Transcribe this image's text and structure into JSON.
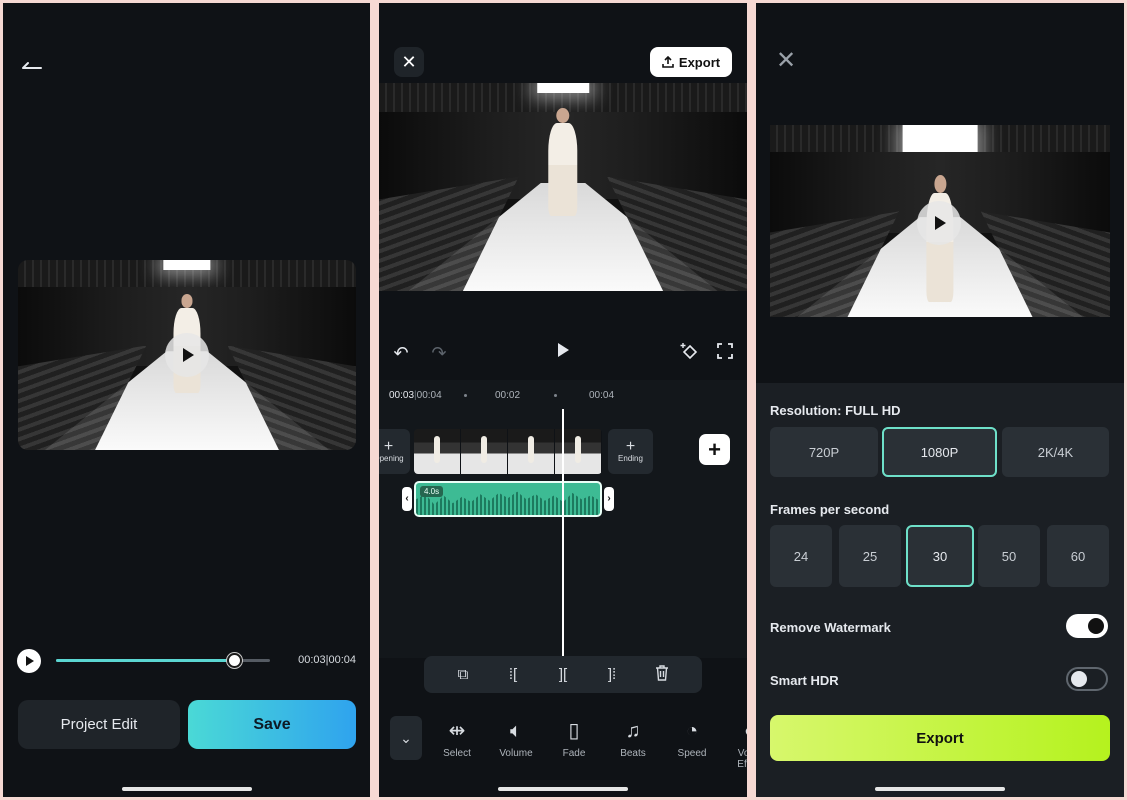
{
  "screen1": {
    "time": "00:03|00:04",
    "progress_fraction": 0.83,
    "project_edit_label": "Project Edit",
    "save_label": "Save"
  },
  "screen2": {
    "export_label": "Export",
    "ruler": {
      "current": "00:03",
      "total": "00:04",
      "mark2": "00:02",
      "mark4": "00:04"
    },
    "opening_label": "Opening",
    "ending_label": "Ending",
    "audio_duration": "4.0s",
    "tools": [
      {
        "icon": "select-icon",
        "label": "Select"
      },
      {
        "icon": "volume-icon",
        "label": "Volume"
      },
      {
        "icon": "fade-icon",
        "label": "Fade"
      },
      {
        "icon": "beats-icon",
        "label": "Beats"
      },
      {
        "icon": "speed-icon",
        "label": "Speed"
      },
      {
        "icon": "voice-effect-icon",
        "label": "Voice Effect"
      }
    ]
  },
  "screen3": {
    "resolution_label": "Resolution: FULL HD",
    "resolutions": [
      "720P",
      "1080P",
      "2K/4K"
    ],
    "resolution_selected": "1080P",
    "fps_label": "Frames per second",
    "fps": [
      "24",
      "25",
      "30",
      "50",
      "60"
    ],
    "fps_selected": "30",
    "watermark_label": "Remove Watermark",
    "watermark_on": true,
    "hdr_label": "Smart HDR",
    "hdr_on": false,
    "export_label": "Export"
  },
  "colors": {
    "background": "#0f1216",
    "accent_teal": "#5bd6d2",
    "save_gradient_end": "#2fa3ee",
    "audio_green": "#3dbb94",
    "export_lime": "#c6f43a",
    "selected_border": "#6ee0c9"
  }
}
